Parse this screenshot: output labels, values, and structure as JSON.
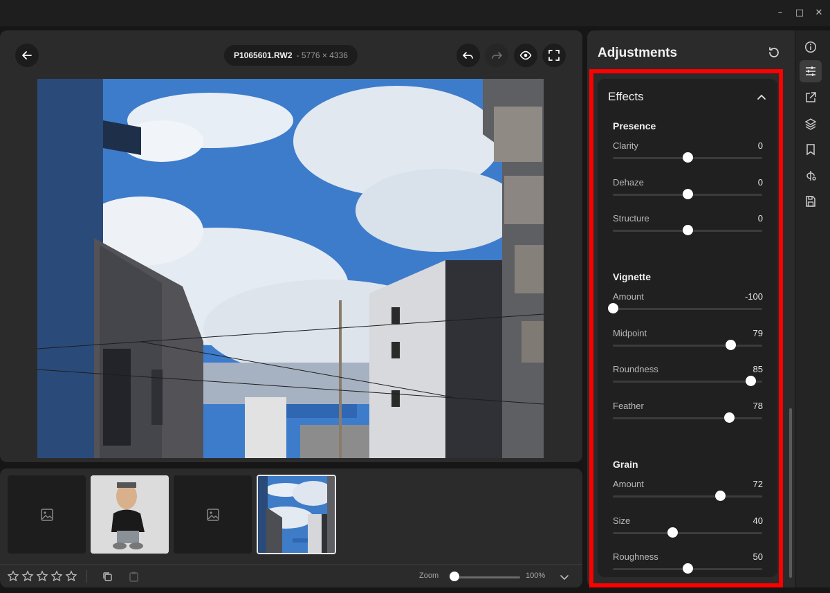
{
  "window": {
    "minimize": "–",
    "maximize": "□",
    "close": "✕"
  },
  "viewer": {
    "file_name": "P1065601.RW2",
    "file_dims": "- 5776 × 4336",
    "buttons": [
      "back-icon",
      "undo-icon",
      "redo-icon",
      "eye-icon",
      "fullscreen-icon"
    ]
  },
  "filmstrip": {
    "thumbnails": [
      {
        "kind": "placeholder",
        "icon": "image-placeholder-icon"
      },
      {
        "kind": "photo",
        "subject": "plush figure"
      },
      {
        "kind": "placeholder",
        "icon": "image-placeholder-icon"
      },
      {
        "kind": "photo",
        "subject": "sky and buildings",
        "selected": true
      }
    ],
    "rating": 0,
    "zoom_label": "Zoom",
    "zoom_value": "100%"
  },
  "adjustments": {
    "title": "Adjustments",
    "effects_title": "Effects",
    "sections": [
      {
        "title": "Presence",
        "sliders": [
          {
            "label": "Clarity",
            "value": "0",
            "min": -100,
            "max": 100
          },
          {
            "label": "Dehaze",
            "value": "0",
            "min": -100,
            "max": 100
          },
          {
            "label": "Structure",
            "value": "0",
            "min": -100,
            "max": 100
          }
        ]
      },
      {
        "title": "Vignette",
        "sliders": [
          {
            "label": "Amount",
            "value": "-100",
            "min": -100,
            "max": 100
          },
          {
            "label": "Midpoint",
            "value": "79",
            "min": 0,
            "max": 100
          },
          {
            "label": "Roundness",
            "value": "85",
            "min": -100,
            "max": 100
          },
          {
            "label": "Feather",
            "value": "78",
            "min": 0,
            "max": 100
          }
        ]
      },
      {
        "title": "Grain",
        "sliders": [
          {
            "label": "Amount",
            "value": "72",
            "min": 0,
            "max": 100
          },
          {
            "label": "Size",
            "value": "40",
            "min": 0,
            "max": 100
          },
          {
            "label": "Roughness",
            "value": "50",
            "min": 0,
            "max": 100
          }
        ]
      }
    ]
  },
  "rail": [
    "info-icon",
    "adjustments-icon",
    "export-icon",
    "layers-icon",
    "bookmark-icon",
    "ai-icon",
    "save-icon"
  ],
  "colors": {
    "highlight": "#ff0000",
    "panel": "#2b2b2b",
    "knob": "#ffffff"
  }
}
